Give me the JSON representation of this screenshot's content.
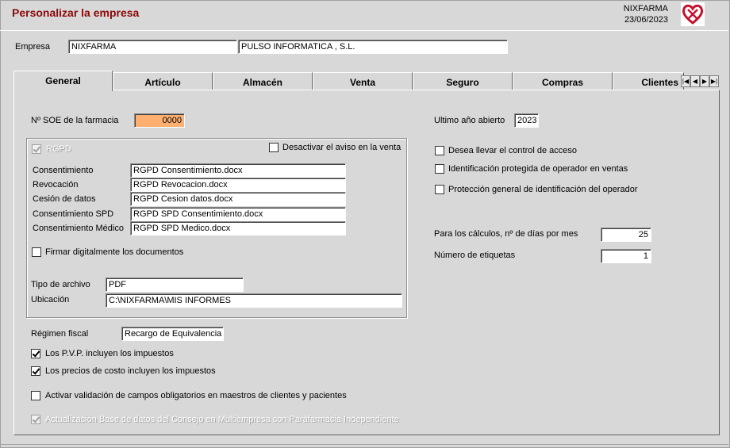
{
  "window": {
    "title": "Personalizar la empresa",
    "company_code": "NIXFARMA",
    "date": "23/06/2023"
  },
  "empresa": {
    "label": "Empresa",
    "code": "NIXFARMA",
    "name": "PULSO INFORMATICA , S.L."
  },
  "tabs": [
    {
      "label": "General",
      "active": true
    },
    {
      "label": "Artículo"
    },
    {
      "label": "Almacén"
    },
    {
      "label": "Venta"
    },
    {
      "label": "Seguro"
    },
    {
      "label": "Compras"
    },
    {
      "label": "Clientes"
    }
  ],
  "tab_nav": {
    "first": "◀|",
    "prev": "◀",
    "next": "▶",
    "last": "|▶"
  },
  "general": {
    "soe_label": "Nº SOE de la farmacia",
    "soe_value": "0000",
    "rgpd": {
      "label": "RGPD",
      "checked": true,
      "desactivar_label": "Desactivar el aviso en la venta",
      "docs": [
        {
          "label": "Consentimiento",
          "value": "RGPD Consentimiento.docx"
        },
        {
          "label": "Revocación",
          "value": "RGPD Revocacion.docx"
        },
        {
          "label": "Cesión de datos",
          "value": "RGPD Cesion datos.docx"
        },
        {
          "label": "Consentimiento SPD",
          "value": "RGPD SPD Consentimiento.docx"
        },
        {
          "label": "Consentimiento Médico",
          "value": "RGPD SPD Medico.docx"
        }
      ],
      "firmar_label": "Firmar digitalmente los documentos",
      "tipo_archivo_label": "Tipo de archivo",
      "tipo_archivo_value": "PDF",
      "ubicacion_label": "Ubicación",
      "ubicacion_value": "C:\\NIXFARMA\\MIS INFORMES"
    },
    "regimen_label": "Régimen fiscal",
    "regimen_value": "Recargo de Equivalencia",
    "pvp_label": "Los P.V.P. incluyen los impuestos",
    "costo_label": "Los precios de costo incluyen los impuestos",
    "validacion_label": "Activar validación de campos obligatorios en maestros de clientes y pacientes",
    "actualizacion_label": "Actualización Base de datos del Consejo en Multiempresa con Parafarmacia Independiente",
    "ultimo_anio_label": "Ultimo año abierto",
    "ultimo_anio_value": "2023",
    "control_acceso_label": "Desea llevar el control de acceso",
    "ident_protegida_label": "Identificación protegida de operador en ventas",
    "proteccion_general_label": "Protección general de identificación del operador",
    "dias_mes_label": "Para los cálculos, nº de días por mes",
    "dias_mes_value": "25",
    "etiquetas_label": "Número de etiquetas",
    "etiquetas_value": "1"
  }
}
